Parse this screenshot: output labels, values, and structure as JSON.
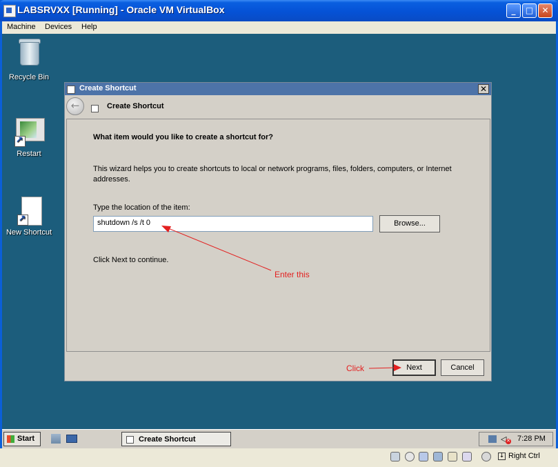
{
  "window": {
    "title": "LABSRVXX [Running] - Oracle VM VirtualBox",
    "menu": [
      "Machine",
      "Devices",
      "Help"
    ]
  },
  "desktop": {
    "icons": [
      {
        "label": "Recycle Bin",
        "icon": "recycle-bin-icon"
      },
      {
        "label": "Restart",
        "icon": "shortcut-icon"
      },
      {
        "label": "New Shortcut",
        "icon": "document-shortcut-icon"
      }
    ]
  },
  "dialog": {
    "title": "Create Shortcut",
    "header_title": "Create Shortcut",
    "question": "What item would you like to create a shortcut for?",
    "description": "This wizard helps you to create shortcuts to local or network programs, files, folders, computers, or Internet addresses.",
    "location_label": "Type the location of the item:",
    "location_value": "shutdown /s /t 0",
    "browse_label": "Browse...",
    "continue_text": "Click Next to continue.",
    "next_label": "Next",
    "cancel_label": "Cancel",
    "close_glyph": "✕",
    "back_glyph": "←"
  },
  "annotations": {
    "enter": "Enter this",
    "click": "Click",
    "color": "#e32020"
  },
  "taskbar": {
    "start_label": "Start",
    "task_label": "Create Shortcut",
    "time": "7:28 PM"
  },
  "statusbar": {
    "host_key": "Right Ctrl"
  },
  "colors": {
    "desktop": "#1c5d7c",
    "dialog_title": "#4d73a8",
    "window_title": "#0552d6"
  }
}
